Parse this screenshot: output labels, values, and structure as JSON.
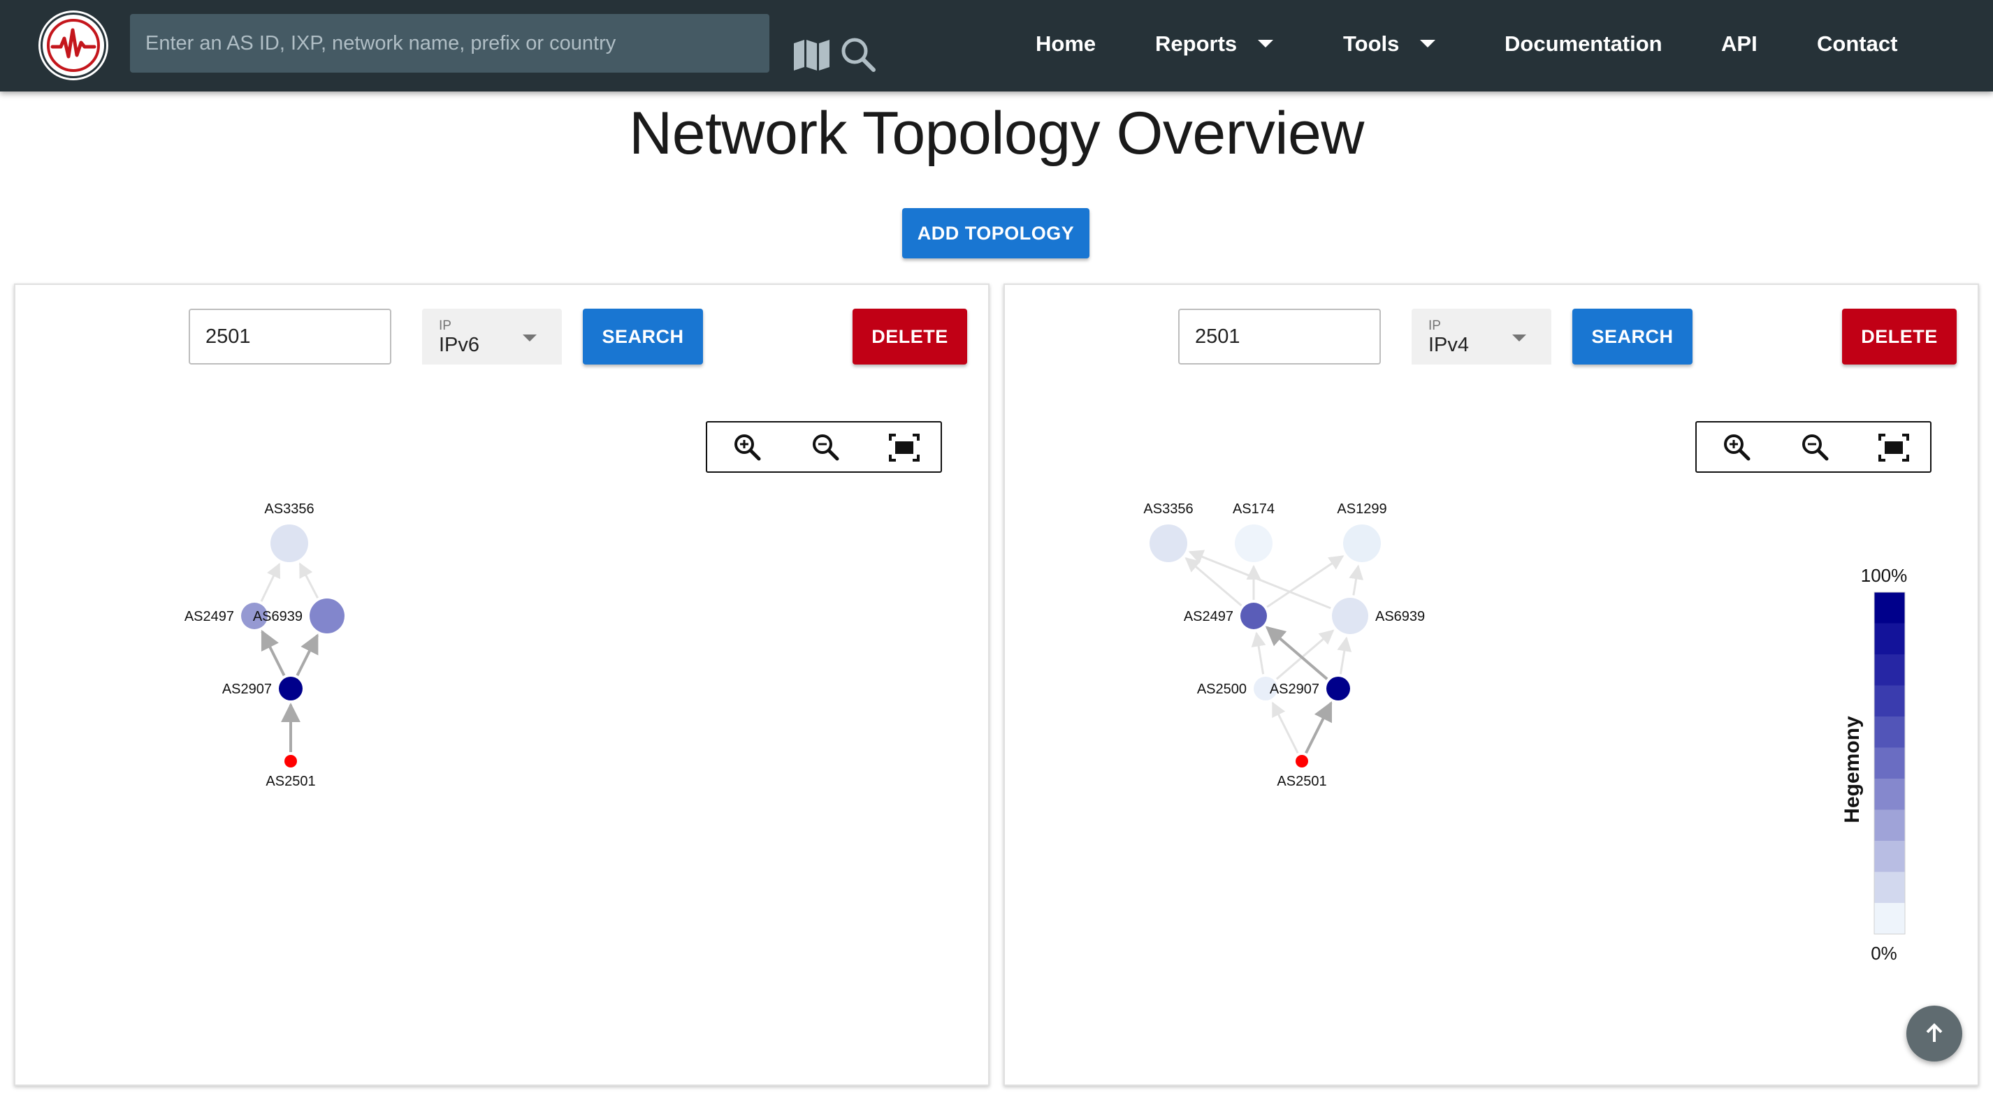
{
  "header": {
    "search_placeholder": "Enter an AS ID, IXP, network name, prefix or country",
    "nav": {
      "home": "Home",
      "reports": "Reports",
      "tools": "Tools",
      "documentation": "Documentation",
      "api": "API",
      "contact": "Contact"
    }
  },
  "page": {
    "title": "Network Topology Overview",
    "add_topology_label": "ADD TOPOLOGY"
  },
  "panels": [
    {
      "as_input_value": "2501",
      "ip_label": "IP",
      "ip_value": "IPv6",
      "search_label": "SEARCH",
      "delete_label": "DELETE",
      "nodes": [
        {
          "id": "AS3356",
          "label": "AS3356",
          "hegemony": 0.12,
          "color": "#dde3f2"
        },
        {
          "id": "AS2497",
          "label": "AS2497",
          "hegemony": 0.45,
          "color": "#9599d2"
        },
        {
          "id": "AS6939",
          "label": "AS6939",
          "hegemony": 0.5,
          "color": "#8286cc"
        },
        {
          "id": "AS2907",
          "label": "AS2907",
          "hegemony": 1.0,
          "color": "#00008b"
        },
        {
          "id": "AS2501",
          "label": "AS2501",
          "origin": true,
          "color": "#ff0000"
        }
      ],
      "edges": [
        {
          "from": "AS2501",
          "to": "AS2907"
        },
        {
          "from": "AS2907",
          "to": "AS2497"
        },
        {
          "from": "AS2907",
          "to": "AS6939"
        },
        {
          "from": "AS2497",
          "to": "AS3356"
        },
        {
          "from": "AS6939",
          "to": "AS3356"
        }
      ]
    },
    {
      "as_input_value": "2501",
      "ip_label": "IP",
      "ip_value": "IPv4",
      "search_label": "SEARCH",
      "delete_label": "DELETE",
      "nodes": [
        {
          "id": "AS3356",
          "label": "AS3356",
          "hegemony": 0.12,
          "color": "#dfe5f3"
        },
        {
          "id": "AS174",
          "label": "AS174",
          "hegemony": 0.05,
          "color": "#eef4fb"
        },
        {
          "id": "AS1299",
          "label": "AS1299",
          "hegemony": 0.07,
          "color": "#e8f0f9"
        },
        {
          "id": "AS2497",
          "label": "AS2497",
          "hegemony": 0.7,
          "color": "#5a5db8"
        },
        {
          "id": "AS6939",
          "label": "AS6939",
          "hegemony": 0.12,
          "color": "#dfe5f3"
        },
        {
          "id": "AS2500",
          "label": "AS2500",
          "hegemony": 0.06,
          "color": "#e9eff9"
        },
        {
          "id": "AS2907",
          "label": "AS2907",
          "hegemony": 1.0,
          "color": "#00008b"
        },
        {
          "id": "AS2501",
          "label": "AS2501",
          "origin": true,
          "color": "#ff0000"
        }
      ],
      "edges": [
        {
          "from": "AS2501",
          "to": "AS2500"
        },
        {
          "from": "AS2501",
          "to": "AS2907"
        },
        {
          "from": "AS2500",
          "to": "AS2497"
        },
        {
          "from": "AS2500",
          "to": "AS6939"
        },
        {
          "from": "AS2907",
          "to": "AS2497"
        },
        {
          "from": "AS2907",
          "to": "AS6939"
        },
        {
          "from": "AS2497",
          "to": "AS3356"
        },
        {
          "from": "AS2497",
          "to": "AS174"
        },
        {
          "from": "AS2497",
          "to": "AS1299"
        },
        {
          "from": "AS6939",
          "to": "AS3356"
        },
        {
          "from": "AS6939",
          "to": "AS1299"
        }
      ],
      "legend": {
        "title": "Hegemony",
        "max_label": "100%",
        "min_label": "0%",
        "colors": [
          "#00008b",
          "#13139a",
          "#2626a4",
          "#3a3cae",
          "#5255b8",
          "#6a6dc2",
          "#8588cd",
          "#9fa3d8",
          "#b8bde3",
          "#d2d8ee",
          "#eef4fb"
        ]
      }
    }
  ],
  "colors": {
    "header_bg": "#263238",
    "search_bg": "#455a64",
    "primary": "#1976d2",
    "danger": "#c10015",
    "edge_strong": "#a9a9a9",
    "edge_faint": "#e3e3e3"
  },
  "icons": {
    "logo": "heartbeat-logo-icon",
    "map": "map-icon",
    "search": "search-icon",
    "zoom_in": "zoom-in-icon",
    "zoom_out": "zoom-out-icon",
    "fit": "fit-screen-icon",
    "scroll_top": "arrow-up-icon"
  }
}
